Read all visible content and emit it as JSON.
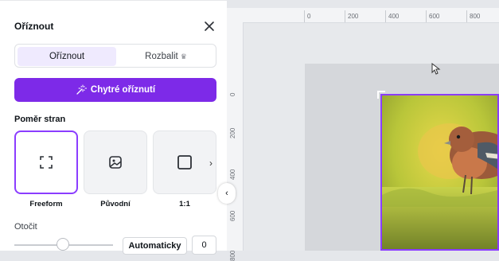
{
  "panel": {
    "title": "Oříznout",
    "tabs": [
      {
        "label": "Oříznout",
        "active": true
      },
      {
        "label": "Rozbalit",
        "badge_icon": "crown-icon"
      }
    ],
    "smart_button": {
      "label": "Chytré oříznutí",
      "icon": "magic-wand-icon"
    },
    "aspect_ratio": {
      "heading": "Poměr stran",
      "options": [
        {
          "label": "Freeform",
          "icon": "freeform-icon",
          "selected": true
        },
        {
          "label": "Původní",
          "icon": "image-icon"
        },
        {
          "label": "1:1",
          "icon": "square-icon"
        }
      ]
    },
    "rotate": {
      "heading": "Otočit",
      "auto_label": "Automaticky",
      "value": "0"
    }
  },
  "ruler": {
    "top_ticks": [
      "0",
      "200",
      "400",
      "600",
      "800"
    ],
    "left_ticks": [
      "0",
      "200",
      "400",
      "600",
      "800"
    ]
  },
  "colors": {
    "accent": "#8b3dff",
    "smart_button": "#7d2ae8",
    "tab_active_bg": "#efeafe"
  }
}
